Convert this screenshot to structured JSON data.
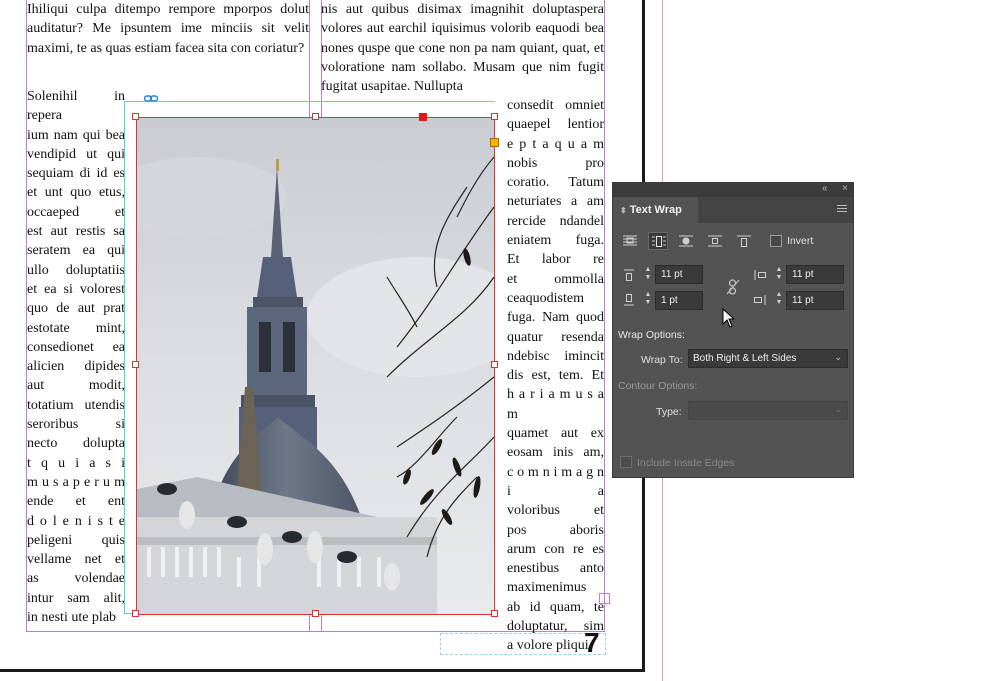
{
  "document": {
    "col1_top_text": "Ihiliqui culpa ditempo rempore mporpos dolut auditatur? Me ipsuntem ime minciis sit velit maximi, te as quas estiam facea sita con coriatur?",
    "col1_wrap_lines": [
      "Solenihil in repera",
      "ium nam qui bea",
      "vendipid ut qui",
      "sequiam di id es",
      "et unt quo etus,",
      "occaeped et",
      "est aut restis sa",
      "seratem ea qui",
      "ullo doluptatiis",
      "et ea si volorest",
      "quo de aut prat",
      "estotate mint,",
      "consedionet ea",
      "alicien dipides",
      "aut modit,",
      "totatium utendis",
      "seroribus si",
      "necto dolupta",
      "t q u i a s i",
      "m u s a p e r u m",
      "ende et ent",
      "d o l e n i s t e",
      "peligeni quis",
      "vellame net et",
      "as volendae",
      "intur sam alit,",
      "in nesti ute plab"
    ],
    "col2_top_text": "nis aut quibus disimax imagnihit doluptaspera volores aut earchil iquisimus volorib eaquodi bea nones quspe que cone non pa nam quiant, quat, et voloratione nam sollabo. Musam que nim fugit fugitat usapitae. Nullupta",
    "col2_wrap_lines": [
      "consedit omniet",
      "quaepel lentior",
      "e p t a q u a m",
      "nobis pro",
      "coratio. Tatum",
      "neturiates a am",
      "rercide ndandel",
      "eniatem fuga.",
      "Et labor re",
      "et ommolla",
      "ceaquodistem",
      "fuga. Nam quod",
      "quatur resenda",
      "ndebisc imincit",
      "dis est, tem. Et",
      "h a r i a m u s a m",
      "quamet aut ex",
      "eosam inis am,",
      "c o m n i m a g n i a",
      "voloribus et",
      "pos aboris",
      "arum con re es",
      "enestibus anto",
      "maximenimus",
      "ab id quam, te",
      "doluptatur, sim",
      "a volore pliqui"
    ],
    "page_number": "7"
  },
  "panel": {
    "title": "Text Wrap",
    "collapse_glyph": "«",
    "close_glyph": "×",
    "invert_label": "Invert",
    "top_offset": "11 pt",
    "bottom_offset": "1 pt",
    "left_offset": "11 pt",
    "right_offset": "11 pt",
    "wrap_options_label": "Wrap Options:",
    "wrap_to_label": "Wrap To:",
    "wrap_to_value": "Both Right & Left Sides",
    "contour_options_label": "Contour Options:",
    "type_label": "Type:",
    "include_inside_edges_label": "Include Inside Edges",
    "wrap_modes": [
      "no-wrap",
      "wrap-around-bounding-box",
      "wrap-around-object-shape",
      "jump-object",
      "jump-to-next-column"
    ],
    "active_wrap_mode": "wrap-around-bounding-box",
    "invert_checked": false,
    "include_inside_edges_checked": false
  },
  "colors": {
    "panel_bg": "#535353",
    "frame_selection": "#e03030",
    "wrap_boundary": "#53d3e2",
    "margin_guide": "#c07ad8",
    "bleed_guide": "#e5a0a8"
  }
}
